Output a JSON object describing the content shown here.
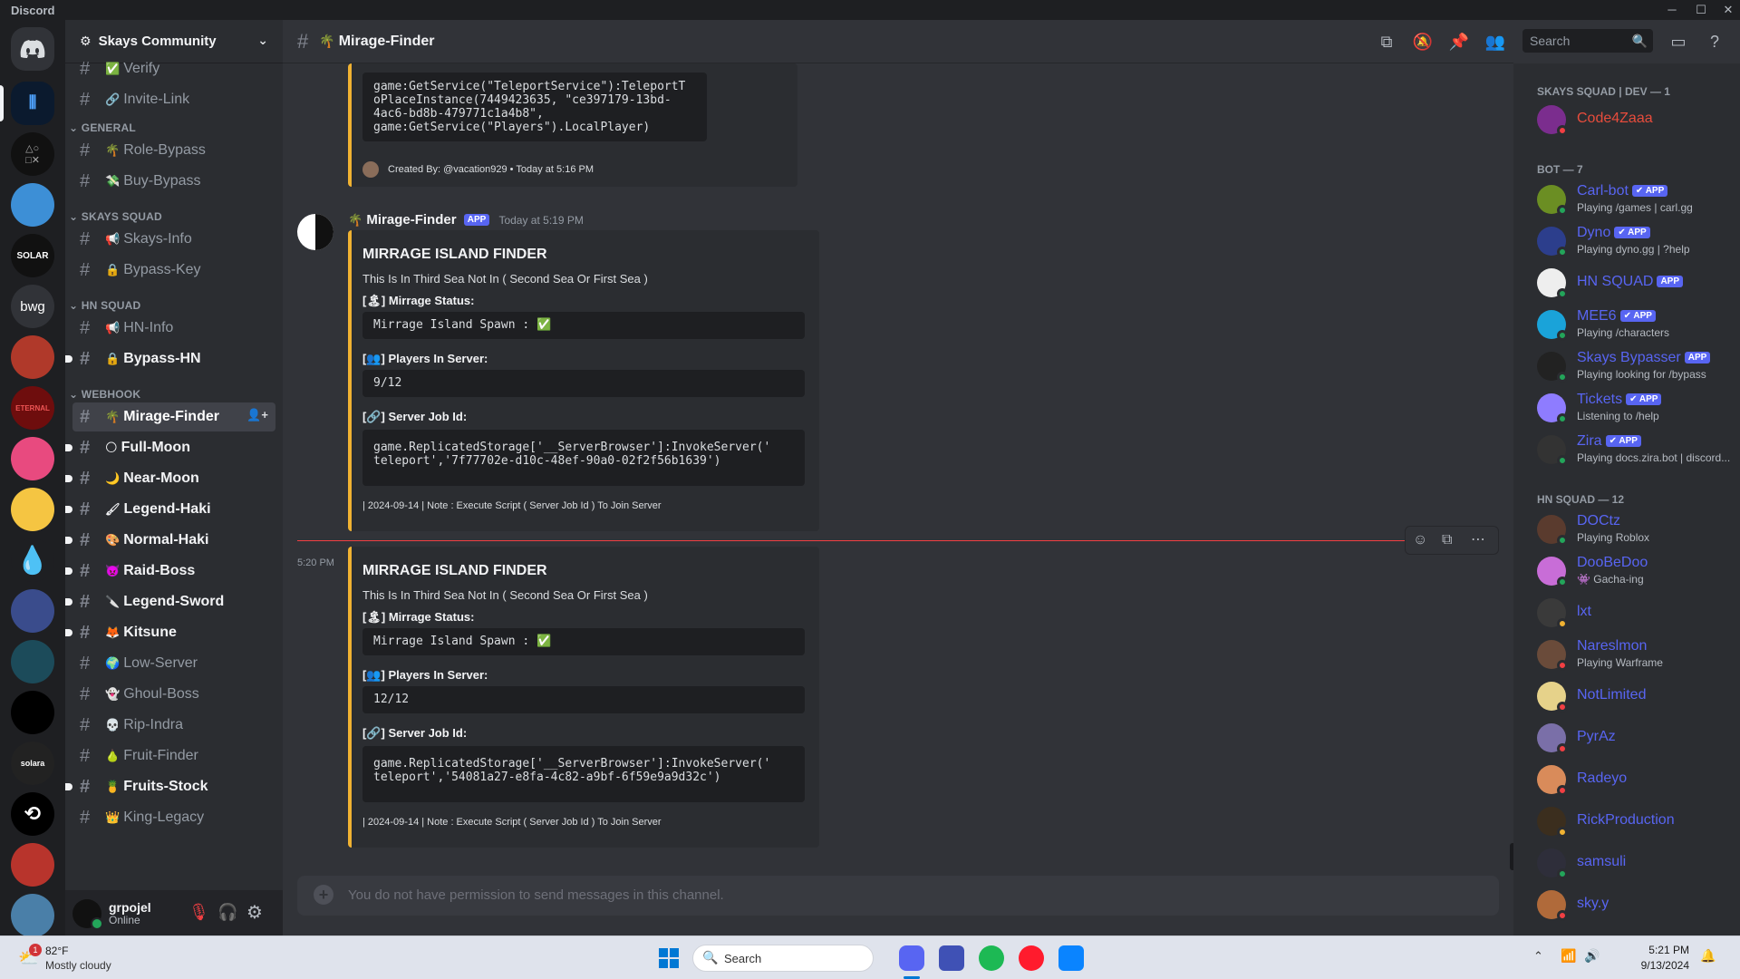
{
  "window": {
    "title": "Discord"
  },
  "server": {
    "name": "Skays Community"
  },
  "channels": {
    "top": [
      {
        "label": "Verify",
        "emoji": "✅"
      },
      {
        "label": "Invite-Link",
        "emoji": "🔗"
      }
    ],
    "categories": [
      {
        "name": "GENERAL",
        "items": [
          {
            "label": "Role-Bypass",
            "emoji": "🌴"
          },
          {
            "label": "Buy-Bypass",
            "emoji": "💸"
          }
        ]
      },
      {
        "name": "SKAYS SQUAD",
        "items": [
          {
            "label": "Skays-Info",
            "emoji": "📢"
          },
          {
            "label": "Bypass-Key",
            "emoji": "🔒"
          }
        ]
      },
      {
        "name": "HN SQUAD",
        "items": [
          {
            "label": "HN-Info",
            "emoji": "📢"
          },
          {
            "label": "Bypass-HN",
            "emoji": "🔒"
          }
        ]
      },
      {
        "name": "WEBHOOK",
        "items": [
          {
            "label": "Mirage-Finder",
            "emoji": "🌴"
          },
          {
            "label": "Full-Moon",
            "emoji": "🌕"
          },
          {
            "label": "Near-Moon",
            "emoji": "🌙"
          },
          {
            "label": "Legend-Haki",
            "emoji": "🖌"
          },
          {
            "label": "Normal-Haki",
            "emoji": "🎨"
          },
          {
            "label": "Raid-Boss",
            "emoji": "👿"
          },
          {
            "label": "Legend-Sword",
            "emoji": "🔪"
          },
          {
            "label": "Kitsune",
            "emoji": "🦊"
          },
          {
            "label": "Low-Server",
            "emoji": "🌍"
          },
          {
            "label": "Ghoul-Boss",
            "emoji": "👻"
          },
          {
            "label": "Rip-Indra",
            "emoji": "💀"
          },
          {
            "label": "Fruit-Finder",
            "emoji": "🍐"
          },
          {
            "label": "Fruits-Stock",
            "emoji": "🍍"
          },
          {
            "label": "King-Legacy",
            "emoji": "👑"
          }
        ]
      }
    ]
  },
  "user": {
    "name": "grpojel",
    "status": "Online"
  },
  "header": {
    "channel": "Mirage-Finder",
    "emoji": "🌴",
    "search_placeholder": "Search"
  },
  "messages": {
    "prev": {
      "code": "game:GetService(\"TeleportService\"):TeleportT\noPlaceInstance(7449423635, \"ce397179-13bd-\n4ac6-bd8b-479771c1a4b8\",\ngame:GetService(\"Players\").LocalPlayer)",
      "footer": "Created By: @vacation929 • Today at 5:16 PM"
    },
    "author": "Mirage-Finder",
    "app_badge": "APP",
    "timestamp": "Today at 5:19 PM",
    "embeds": [
      {
        "title": "MIRRAGE ISLAND FINDER",
        "desc": "This Is In Third Sea Not In ( Second Sea Or First Sea )",
        "f1": "Mirrage Status:",
        "f1_code": "Mirrage Island Spawn : ✅",
        "f2": "Players In Server:",
        "f2_code": "9/12",
        "f3": "Server Job Id:",
        "f3_code": "game.ReplicatedStorage['__ServerBrowser']:InvokeServer('\nteleport','7f77702e-d10c-48ef-90a0-02f2f56b1639')",
        "footer": "| 2024-09-14 | Note : Execute Script ( Server Job Id ) To Join Server"
      },
      {
        "time": "5:20 PM",
        "title": "MIRRAGE ISLAND FINDER",
        "desc": "This Is In Third Sea Not In ( Second Sea Or First Sea )",
        "f1": "Mirrage Status:",
        "f1_code": "Mirrage Island Spawn : ✅",
        "f2": "Players In Server:",
        "f2_code": "12/12",
        "f3": "Server Job Id:",
        "f3_code": "game.ReplicatedStorage['__ServerBrowser']:InvokeServer('\nteleport','54081a27-e8fa-4c82-a9bf-6f59e9a9d32c')",
        "footer": "| 2024-09-14 | Note : Execute Script ( Server Job Id ) To Join Server"
      }
    ]
  },
  "composer": {
    "placeholder": "You do not have permission to send messages in this channel."
  },
  "members": {
    "cat1": "SKAYS SQUAD | DEV — 1",
    "cat2": "BOT — 7",
    "cat3": "HN SQUAD — 12",
    "dev": [
      {
        "name": "Code4Zaaa",
        "sub": ""
      }
    ],
    "bots": [
      {
        "name": "Carl-bot",
        "badge": "✔ APP",
        "sub": "Playing /games | carl.gg"
      },
      {
        "name": "Dyno",
        "badge": "✔ APP",
        "sub": "Playing dyno.gg | ?help"
      },
      {
        "name": "HN SQUAD",
        "badge": "APP",
        "sub": ""
      },
      {
        "name": "MEE6",
        "badge": "✔ APP",
        "sub": "Playing /characters"
      },
      {
        "name": "Skays Bypasser",
        "badge": "APP",
        "sub": "Playing looking for /bypass"
      },
      {
        "name": "Tickets",
        "badge": "✔ APP",
        "sub": "Listening to /help"
      },
      {
        "name": "Zira",
        "badge": "✔ APP",
        "sub": "Playing docs.zira.bot | discord..."
      }
    ],
    "hn": [
      {
        "name": "DOCtz",
        "sub": "Playing Roblox"
      },
      {
        "name": "DooBeDoo",
        "sub": "👾 Gacha-ing"
      },
      {
        "name": "lxt",
        "sub": ""
      },
      {
        "name": "Nareslmon",
        "sub": "Playing Warframe"
      },
      {
        "name": "NotLimited",
        "sub": ""
      },
      {
        "name": "PyrAz",
        "sub": ""
      },
      {
        "name": "Radeyo",
        "sub": ""
      },
      {
        "name": "RickProduction",
        "sub": ""
      },
      {
        "name": "samsuli",
        "sub": ""
      },
      {
        "name": "sky.y",
        "sub": ""
      }
    ]
  },
  "taskbar": {
    "weather_temp": "82°F",
    "weather_desc": "Mostly cloudy",
    "weather_badge": "1",
    "search": "Search",
    "time": "5:21 PM",
    "date": "9/13/2024"
  },
  "colors": {
    "accent": "#5865f2",
    "embed_bar": "#f0b232",
    "online": "#23a55a",
    "dnd": "#f23f43",
    "idle": "#f0b232"
  }
}
